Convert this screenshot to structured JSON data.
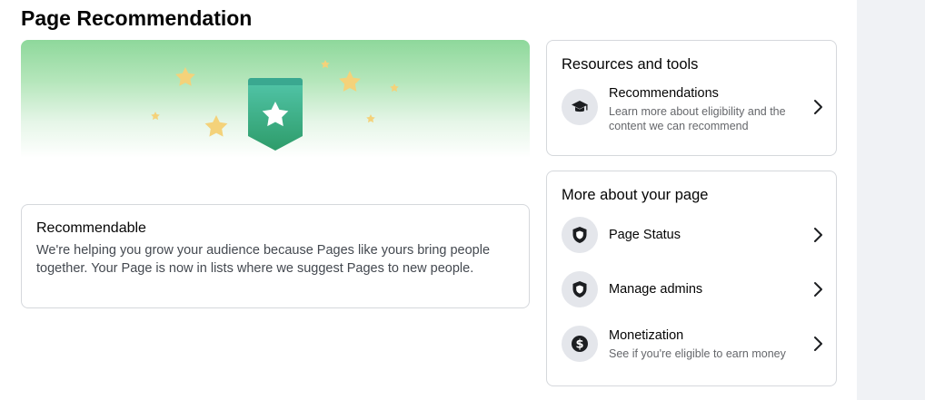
{
  "page": {
    "title": "Page Recommendation"
  },
  "recommendable": {
    "title": "Recommendable",
    "body": "We're helping you grow your audience because Pages like yours bring people together. Your Page is now in lists where we suggest Pages to new people."
  },
  "resources": {
    "heading": "Resources and tools",
    "items": [
      {
        "title": "Recommendations",
        "subtitle": "Learn more about eligibility and the content we can recommend",
        "icon": "graduation-cap-icon"
      }
    ]
  },
  "more": {
    "heading": "More about your page",
    "items": [
      {
        "title": "Page Status",
        "icon": "shield-icon"
      },
      {
        "title": "Manage admins",
        "icon": "shield-icon"
      },
      {
        "title": "Monetization",
        "subtitle": "See if you're eligible to earn money",
        "icon": "dollar-icon"
      }
    ]
  },
  "colors": {
    "hero_green": "#8ed89b",
    "badge_green": "#3bb077",
    "star_yellow": "#f4d27a",
    "gutter": "#f0f2f5",
    "border": "#d5d8dc",
    "secondary_text": "#65676b"
  }
}
